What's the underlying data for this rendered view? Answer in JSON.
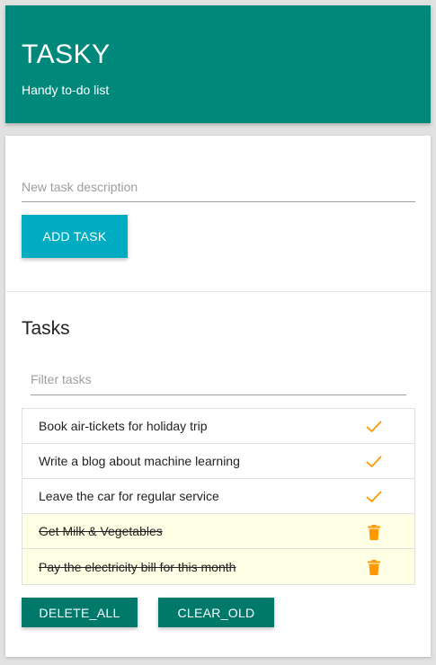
{
  "header": {
    "title": "TASKY",
    "subtitle": "Handy to-do list"
  },
  "new_task": {
    "placeholder": "New task description",
    "value": "",
    "add_label": "ADD TASK"
  },
  "tasks_section": {
    "title": "Tasks",
    "filter_placeholder": "Filter tasks",
    "items": [
      {
        "text": "Book air-tickets for holiday trip",
        "done": false,
        "action_icon": "check-icon"
      },
      {
        "text": "Write a blog about machine learning",
        "done": false,
        "action_icon": "check-icon"
      },
      {
        "text": "Leave the car for regular service",
        "done": false,
        "action_icon": "check-icon"
      },
      {
        "text": "Get Milk & Vegetables",
        "done": true,
        "action_icon": "trash-icon"
      },
      {
        "text": "Pay the electricity bill for this month",
        "done": true,
        "action_icon": "trash-icon"
      }
    ]
  },
  "actions": {
    "delete_all_label": "DELETE_ALL",
    "clear_old_label": "CLEAR_OLD"
  },
  "colors": {
    "primary": "#00897b",
    "accent": "#00acc1",
    "dark_button": "#00796b",
    "icon": "#ff9800",
    "done_row_bg": "#ffffe6"
  }
}
